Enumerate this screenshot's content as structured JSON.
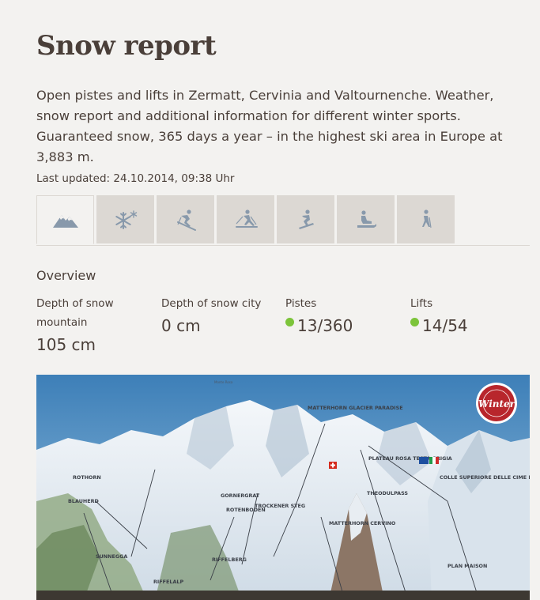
{
  "page": {
    "title": "Snow report",
    "intro": "Open pistes and lifts in Zermatt, Cervinia and Valtournenche. Weather, snow report and additional information for different winter sports. Guaranteed snow, 365 days a year – in the highest ski area in Europe at 3,883 m.",
    "last_updated": "Last updated: 24.10.2014, 09:38 Uhr"
  },
  "tabs": [
    {
      "icon": "mountain-icon",
      "active": true
    },
    {
      "icon": "snowflake-icon",
      "active": false
    },
    {
      "icon": "skier-icon",
      "active": false
    },
    {
      "icon": "cross-country-skier-icon",
      "active": false
    },
    {
      "icon": "snowboarder-icon",
      "active": false
    },
    {
      "icon": "sledge-icon",
      "active": false
    },
    {
      "icon": "hiker-icon",
      "active": false
    }
  ],
  "overview": {
    "heading": "Overview",
    "stats": [
      {
        "label": "Depth of snow mountain",
        "value": "105 cm",
        "status": null
      },
      {
        "label": "Depth of snow city",
        "value": "0 cm",
        "status": null
      },
      {
        "label": "Pistes",
        "value": "13/360",
        "status": "open"
      },
      {
        "label": "Lifts",
        "value": "14/54",
        "status": "open"
      }
    ]
  },
  "map": {
    "labels": {
      "monte_rosa": "Monte Rosa",
      "matterhorn_glacier_paradise": "MATTERHORN GLACIER PARADISE",
      "plateau_rosa": "PLATEAU ROSA TESTA GRIGIA",
      "colle_superiore": "COLLE SUPERIORE DELLE CIME BIANCHE",
      "rothorn": "ROTHORN",
      "gornergrat": "GORNERGRAT",
      "theodulpass": "THEODULPASS",
      "blauherd": "BLAUHERD",
      "rotenboden": "ROTENBODEN",
      "trockener_steg": "TROCKENER STEG",
      "matterhorn_cervino": "MATTERHORN CERVINO",
      "sunnegga": "SUNNEGGA",
      "riffelberg": "RIFFELBERG",
      "riffelalp": "RIFFELALP",
      "plan_maison": "PLAN MAISON",
      "badge": "Winter"
    }
  },
  "colors": {
    "text": "#4a3f39",
    "tab_bg": "#dcd8d3",
    "open_status": "#7cc43a",
    "icon": "#8899ab"
  }
}
